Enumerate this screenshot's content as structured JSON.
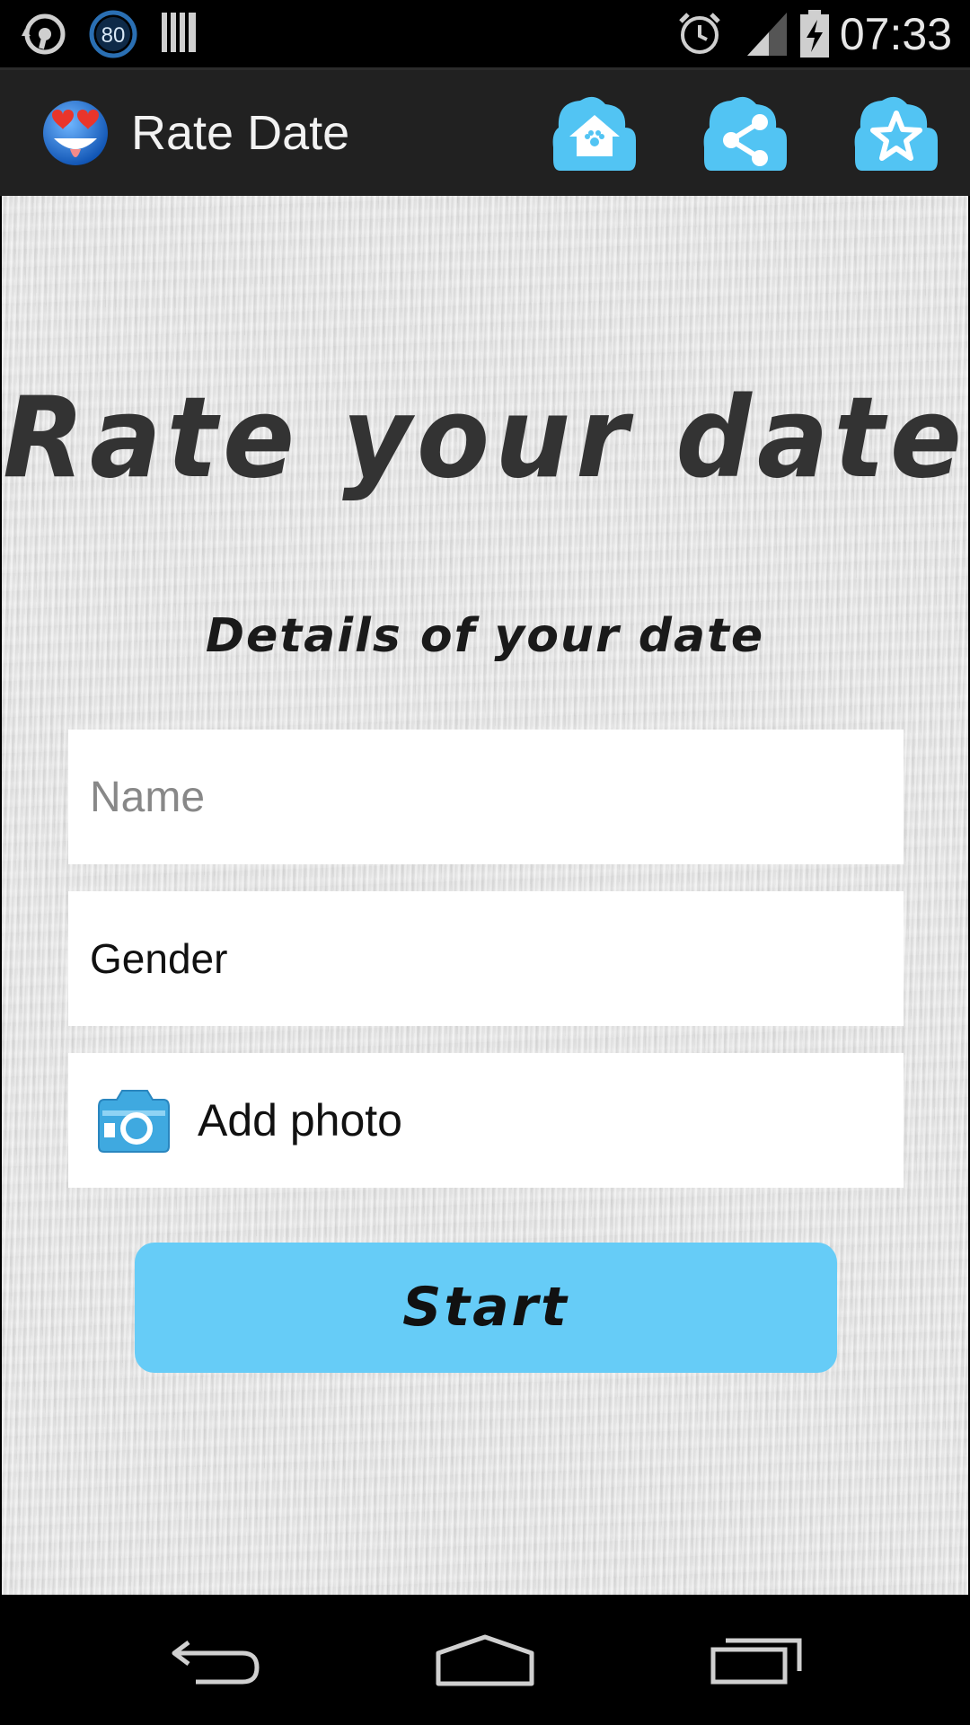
{
  "status_bar": {
    "battery_saver_badge": "80",
    "time": "07:33"
  },
  "action_bar": {
    "title": "Rate Date",
    "actions": [
      {
        "name": "home",
        "icon": "home-icon"
      },
      {
        "name": "share",
        "icon": "share-icon"
      },
      {
        "name": "favorite",
        "icon": "star-icon"
      }
    ]
  },
  "main": {
    "headline": "Rate your date",
    "subheadline": "Details of your date",
    "name_field": {
      "value": "",
      "placeholder": "Name"
    },
    "gender_field": {
      "value": "Gender"
    },
    "photo_field": {
      "label": "Add photo",
      "icon": "camera-icon"
    },
    "start_button": {
      "label": "Start"
    }
  },
  "nav_bar": {
    "buttons": [
      "back",
      "home",
      "recent-apps"
    ]
  },
  "colors": {
    "accent": "#66ccf7",
    "action_bar_bg": "#212121",
    "content_bg": "#e3e3e3"
  }
}
